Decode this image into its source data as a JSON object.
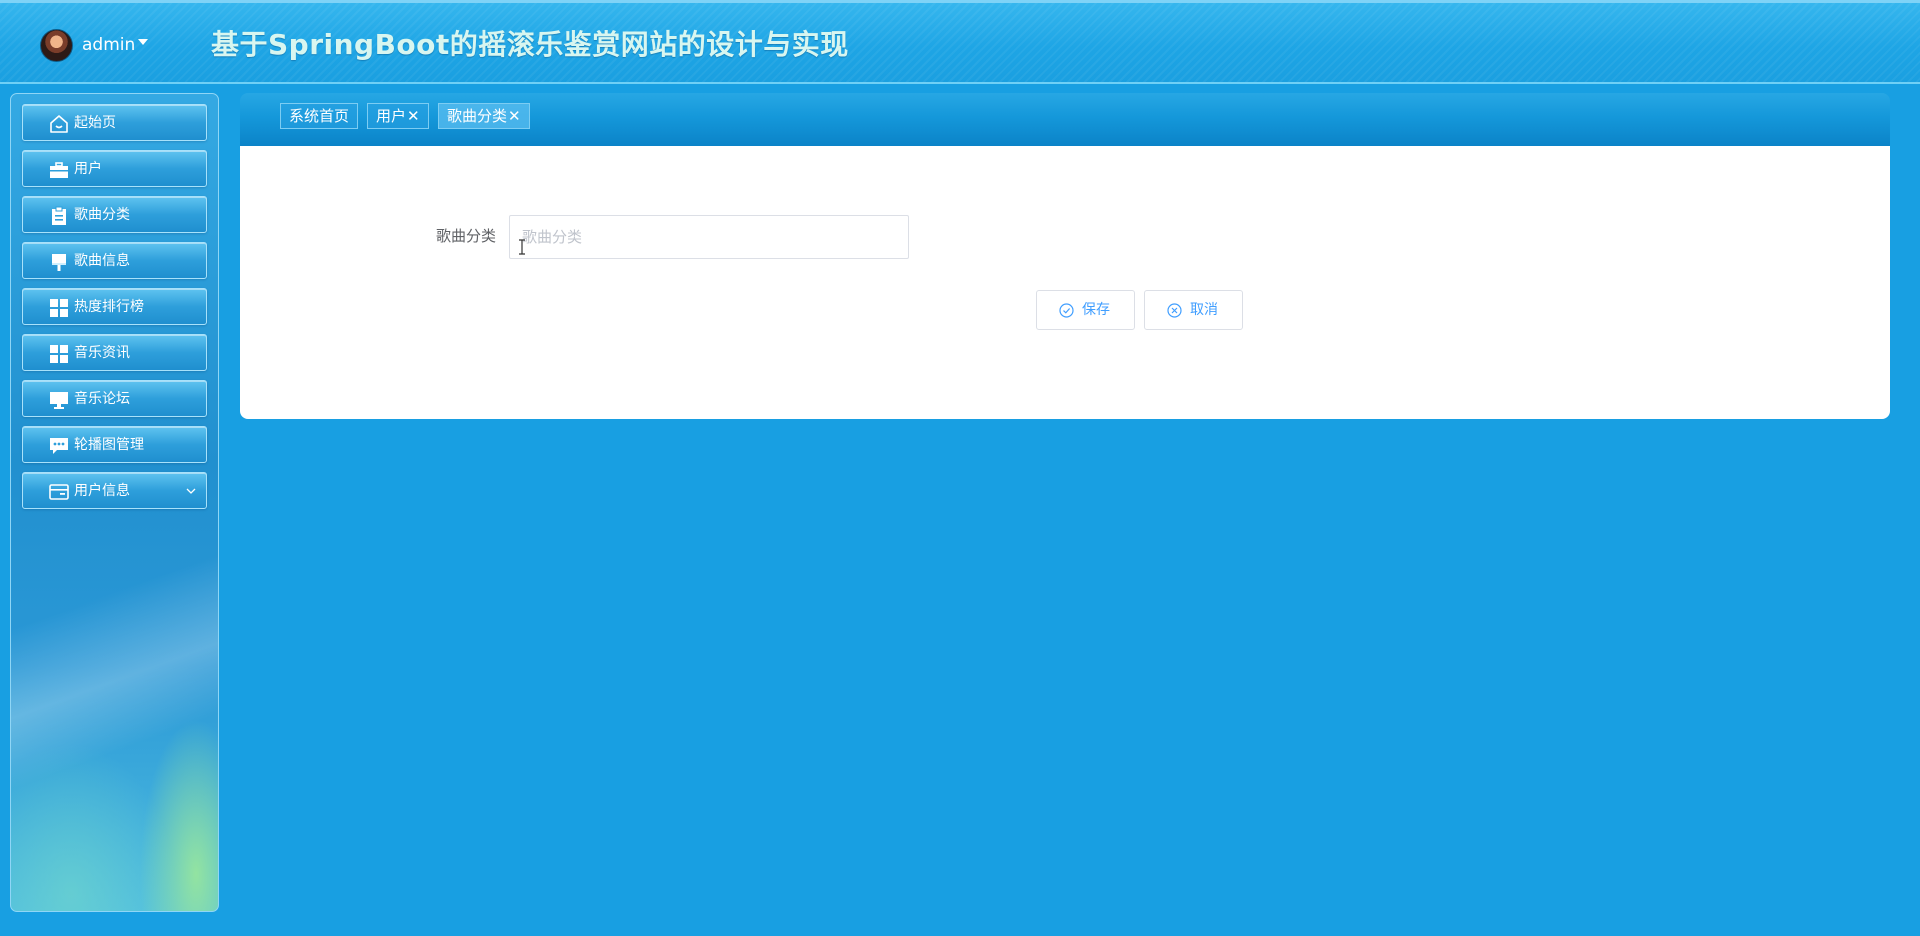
{
  "header": {
    "username": "admin",
    "site_title": "基于SpringBoot的摇滚乐鉴赏网站的设计与实现"
  },
  "sidebar": {
    "items": [
      {
        "label": "起始页",
        "icon": "home-icon"
      },
      {
        "label": "用户",
        "icon": "briefcase-icon"
      },
      {
        "label": "歌曲分类",
        "icon": "clipboard-icon"
      },
      {
        "label": "歌曲信息",
        "icon": "brush-icon"
      },
      {
        "label": "热度排行榜",
        "icon": "grid-icon"
      },
      {
        "label": "音乐资讯",
        "icon": "grid-icon"
      },
      {
        "label": "音乐论坛",
        "icon": "monitor-icon"
      },
      {
        "label": "轮播图管理",
        "icon": "chat-icon"
      },
      {
        "label": "用户信息",
        "icon": "card-icon",
        "expandable": true
      }
    ]
  },
  "tabs": [
    {
      "label": "系统首页",
      "closable": false
    },
    {
      "label": "用户",
      "closable": true,
      "close_glyph": "✕"
    },
    {
      "label": "歌曲分类",
      "closable": true,
      "close_glyph": "✕",
      "active": true
    }
  ],
  "form": {
    "field_label": "歌曲分类",
    "field_placeholder": "歌曲分类",
    "field_value": "",
    "save_label": "保存",
    "cancel_label": "取消"
  },
  "colors": {
    "background": "#189fe2",
    "accent": "#409eff",
    "title": "#d8f6f0"
  }
}
